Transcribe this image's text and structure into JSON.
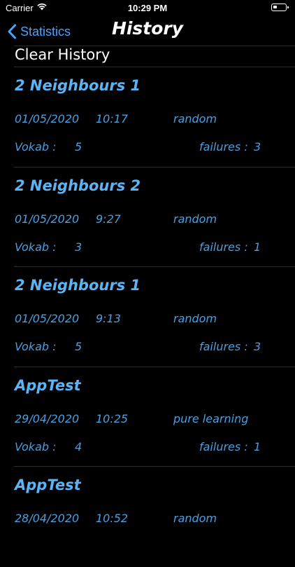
{
  "status_bar": {
    "carrier": "Carrier",
    "time": "10:29 PM"
  },
  "nav": {
    "back_label": "Statistics",
    "title": "History"
  },
  "clear_history_label": "Clear History",
  "entries": [
    {
      "title": "2 Neighbours 1",
      "date": "01/05/2020",
      "time": "10:17",
      "mode": "random",
      "vokab_label": "Vokab :",
      "vokab_value": "5",
      "failures_label": "failures :",
      "failures_value": "3"
    },
    {
      "title": "2 Neighbours 2",
      "date": "01/05/2020",
      "time": "9:27",
      "mode": "random",
      "vokab_label": "Vokab :",
      "vokab_value": "3",
      "failures_label": "failures :",
      "failures_value": "1"
    },
    {
      "title": "2 Neighbours 1",
      "date": "01/05/2020",
      "time": "9:13",
      "mode": "random",
      "vokab_label": "Vokab :",
      "vokab_value": "5",
      "failures_label": "failures :",
      "failures_value": "3"
    },
    {
      "title": "AppTest",
      "date": "29/04/2020",
      "time": "10:25",
      "mode": "pure learning",
      "vokab_label": "Vokab :",
      "vokab_value": "4",
      "failures_label": "failures :",
      "failures_value": "1"
    },
    {
      "title": "AppTest",
      "date": "28/04/2020",
      "time": "10:52",
      "mode": "random",
      "vokab_label": "",
      "vokab_value": "",
      "failures_label": "",
      "failures_value": ""
    }
  ],
  "colors": {
    "background": "#000000",
    "accent": "#4aa3ff",
    "entry_title": "#5ab4f5",
    "entry_text": "#4a9fe0"
  },
  "icons": {
    "back": "chevron-left-icon",
    "wifi": "wifi-icon",
    "battery": "battery-icon"
  }
}
